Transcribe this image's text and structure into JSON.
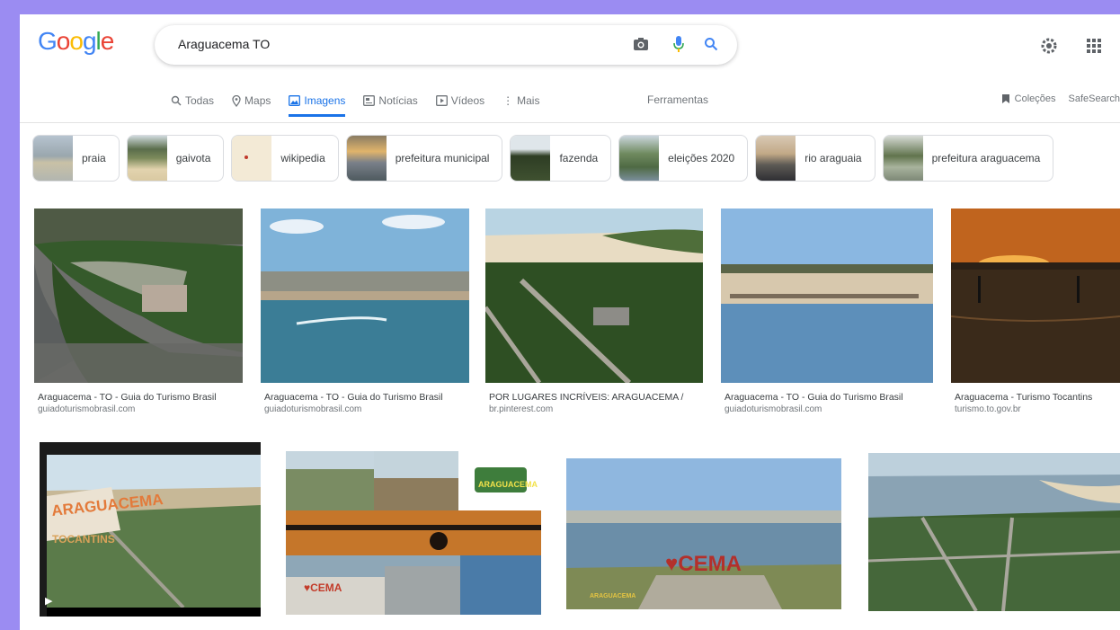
{
  "logo": {
    "letters": [
      "G",
      "o",
      "o",
      "g",
      "l",
      "e"
    ],
    "colors": [
      "#4285f4",
      "#ea4335",
      "#fbbc05",
      "#4285f4",
      "#34a853",
      "#ea4335"
    ]
  },
  "search": {
    "query": "Araguacema TO"
  },
  "icons": {
    "camera": "camera-icon",
    "mic": "mic-icon",
    "search": "search-icon",
    "settings": "gear-icon",
    "apps": "apps-grid-icon"
  },
  "tabs": [
    {
      "label": "Todas",
      "icon": "search-icon"
    },
    {
      "label": "Maps",
      "icon": "map-pin-icon"
    },
    {
      "label": "Imagens",
      "icon": "image-icon",
      "active": true
    },
    {
      "label": "Notícias",
      "icon": "news-icon"
    },
    {
      "label": "Vídeos",
      "icon": "video-icon"
    },
    {
      "label": "Mais",
      "icon": "more-icon"
    }
  ],
  "tools": "Ferramentas",
  "right_links": {
    "collections": "Coleções",
    "safesearch": "SafeSearch"
  },
  "chips": [
    {
      "label": "praia"
    },
    {
      "label": "gaivota"
    },
    {
      "label": "wikipedia"
    },
    {
      "label": "prefeitura municipal"
    },
    {
      "label": "fazenda"
    },
    {
      "label": "eleições 2020"
    },
    {
      "label": "rio araguaia"
    },
    {
      "label": "prefeitura araguacema"
    }
  ],
  "results_row1": [
    {
      "title": "Araguacema - TO - Guia do Turismo Brasil",
      "source": "guiadoturismobrasil.com"
    },
    {
      "title": "Araguacema - TO - Guia do Turismo Brasil",
      "source": "guiadoturismobrasil.com"
    },
    {
      "title": "POR LUGARES INCRÍVEIS: ARAGUACEMA /",
      "source": "br.pinterest.com"
    },
    {
      "title": "Araguacema - TO - Guia do Turismo Brasil",
      "source": "guiadoturismobrasil.com"
    },
    {
      "title": "Araguacema - Turismo Tocantins",
      "source": "turismo.to.gov.br"
    }
  ],
  "results_row2": [
    {
      "overlay_main": "ARAGUACEMA",
      "overlay_sub": "TOCANTINS"
    },
    {
      "overlay_main": "ARAGUACEMA",
      "overlay_sub": "♥CEMA"
    },
    {
      "overlay_main": "♥CEMA",
      "overlay_sub": "ARAGUACEMA"
    },
    {
      "overlay_main": "",
      "overlay_sub": ""
    }
  ]
}
